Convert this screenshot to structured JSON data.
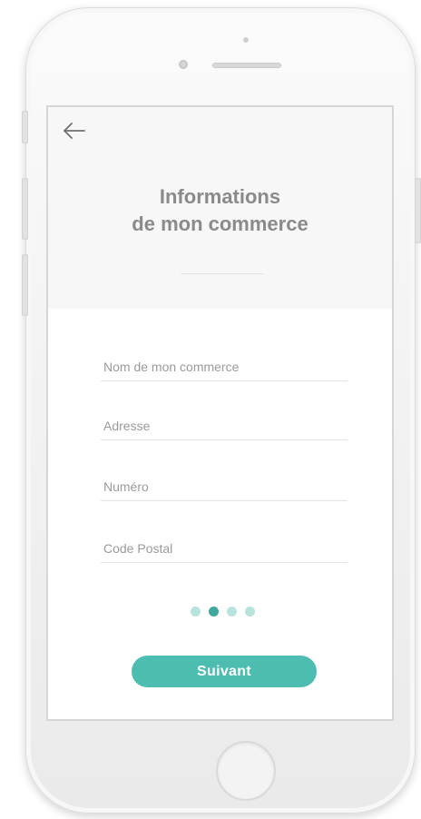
{
  "header": {
    "title_line1": "Informations",
    "title_line2": "de mon commerce",
    "back_icon": "arrow-left-icon"
  },
  "form": {
    "fields": [
      {
        "placeholder": "Nom de mon commerce",
        "value": ""
      },
      {
        "placeholder": "Adresse",
        "value": ""
      },
      {
        "placeholder": "Numéro",
        "value": ""
      },
      {
        "placeholder": "Code Postal",
        "value": ""
      }
    ]
  },
  "pager": {
    "total": 4,
    "current": 2
  },
  "actions": {
    "next_label": "Suivant"
  },
  "colors": {
    "accent": "#4cbdb0",
    "accent_dark": "#3fa99d",
    "accent_light": "#b8e2dc",
    "title": "#8a8a8a",
    "header_bg": "#f7f7f7"
  }
}
